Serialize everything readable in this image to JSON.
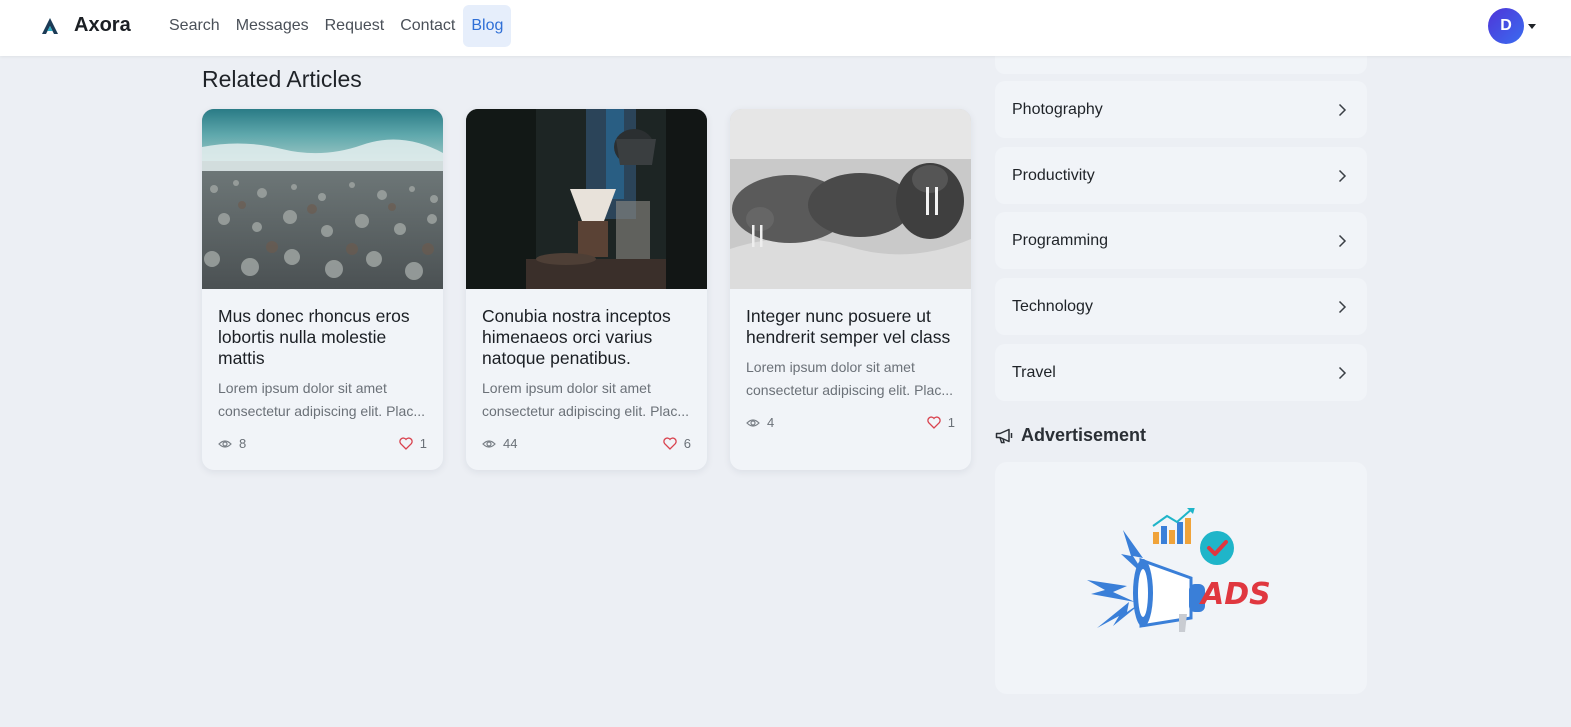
{
  "header": {
    "brand": "Axora",
    "nav": [
      "Search",
      "Messages",
      "Request",
      "Contact",
      "Blog"
    ],
    "active_nav": "Blog",
    "avatar_initial": "D",
    "accent_color": "#2f6fd6"
  },
  "related": {
    "title": "Related Articles",
    "cards": [
      {
        "title": "Mus donec rhoncus eros lobortis nulla molestie mattis",
        "excerpt": "Lorem ipsum dolor sit amet consectetur adipiscing elit. Plac...",
        "views": "8",
        "likes": "1",
        "image": "pebble-beach-photo"
      },
      {
        "title": "Conubia nostra inceptos himenaeos orci varius natoque penatibus.",
        "excerpt": "Lorem ipsum dolor sit amet consectetur adipiscing elit. Plac...",
        "views": "44",
        "likes": "6",
        "image": "coffee-pour-over-photo"
      },
      {
        "title": "Integer nunc posuere ut hendrerit semper vel class",
        "excerpt": "Lorem ipsum dolor sit amet consectetur adipiscing elit. Plac...",
        "views": "4",
        "likes": "1",
        "image": "walrus-bw-photo"
      }
    ]
  },
  "sidebar": {
    "categories": [
      "Photography",
      "Productivity",
      "Programming",
      "Technology",
      "Travel"
    ],
    "ad_heading": "Advertisement",
    "ad_text": "ADS"
  },
  "colors": {
    "like_heart": "#d9434f",
    "ad_red": "#e0373f",
    "ad_blue": "#3a7fd8",
    "ad_teal": "#1fb5c9"
  }
}
